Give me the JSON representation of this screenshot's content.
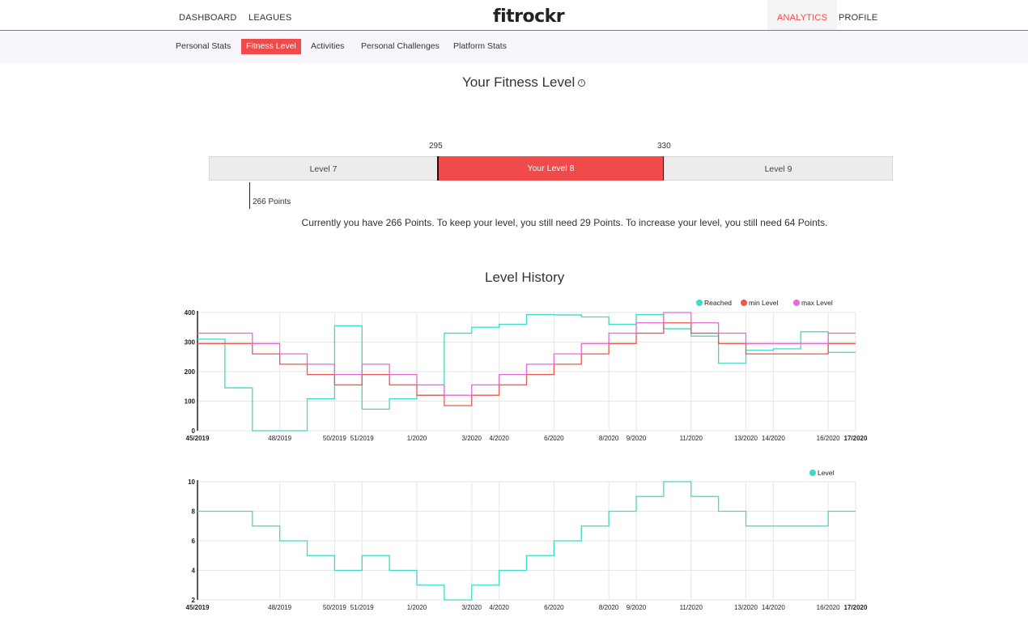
{
  "topnav": {
    "left": [
      "DASHBOARD",
      "LEAGUES"
    ],
    "logo": "fitrockr",
    "right": [
      "ANALYTICS",
      "PROFILE"
    ],
    "active": "ANALYTICS"
  },
  "subnav": {
    "tabs": [
      "Personal Stats",
      "Fitness Level",
      "Activities",
      "Personal Challenges",
      "Platform Stats"
    ],
    "active": "Fitness Level"
  },
  "fitness": {
    "title": "Your Fitness Level",
    "info_icon": "info-icon",
    "thresholds": [
      "295",
      "330"
    ],
    "levels": [
      "Level 7",
      "Your Level 8",
      "Level 9"
    ],
    "current_points_label": "266 Points",
    "current_points": 266,
    "summary": "Currently you have 266 Points. To keep your level, you still need 29 Points. To increase your level, you still need 64 Points."
  },
  "history": {
    "title": "Level History"
  },
  "colors": {
    "accent": "#f04a4a",
    "reached": "#3fd9c6",
    "min_level": "#e8584f",
    "max_level": "#e76ad3"
  },
  "chart_data": [
    {
      "type": "line",
      "step": true,
      "x": [
        "45/2019",
        "46/2019",
        "47/2019",
        "48/2019",
        "49/2019",
        "50/2019",
        "51/2019",
        "52/2019",
        "1/2020",
        "2/2020",
        "3/2020",
        "4/2020",
        "5/2020",
        "6/2020",
        "7/2020",
        "8/2020",
        "9/2020",
        "10/2020",
        "11/2020",
        "12/2020",
        "13/2020",
        "14/2020",
        "15/2020",
        "16/2020",
        "17/2020"
      ],
      "x_tick_labels": [
        "45/2019",
        "48/2019",
        "50/2019",
        "51/2019",
        "1/2020",
        "3/2020",
        "4/2020",
        "6/2020",
        "8/2020",
        "9/2020",
        "11/2020",
        "13/2020",
        "14/2020",
        "16/2020",
        "17/2020"
      ],
      "series": [
        {
          "name": "Reached",
          "color": "#3fd9c6",
          "values": [
            310,
            145,
            0,
            0,
            108,
            355,
            73,
            108,
            120,
            330,
            350,
            360,
            393,
            392,
            385,
            360,
            393,
            345,
            320,
            228,
            272,
            277,
            335,
            265,
            265
          ]
        },
        {
          "name": "min Level",
          "color": "#e8584f",
          "values": [
            295,
            295,
            260,
            225,
            190,
            155,
            190,
            155,
            120,
            85,
            120,
            155,
            190,
            225,
            260,
            295,
            330,
            365,
            330,
            295,
            260,
            260,
            260,
            295,
            295
          ]
        },
        {
          "name": "max Level",
          "color": "#e76ad3",
          "values": [
            330,
            330,
            295,
            260,
            225,
            190,
            225,
            190,
            155,
            120,
            155,
            190,
            225,
            260,
            295,
            330,
            365,
            400,
            365,
            330,
            295,
            295,
            295,
            330,
            330
          ]
        }
      ],
      "ylim": [
        0,
        400
      ],
      "y_ticks": [
        0,
        100,
        200,
        300,
        400
      ],
      "grid": true,
      "legend": "top-right"
    },
    {
      "type": "line",
      "step": true,
      "x": [
        "45/2019",
        "46/2019",
        "47/2019",
        "48/2019",
        "49/2019",
        "50/2019",
        "51/2019",
        "52/2019",
        "1/2020",
        "2/2020",
        "3/2020",
        "4/2020",
        "5/2020",
        "6/2020",
        "7/2020",
        "8/2020",
        "9/2020",
        "10/2020",
        "11/2020",
        "12/2020",
        "13/2020",
        "14/2020",
        "15/2020",
        "16/2020",
        "17/2020"
      ],
      "x_tick_labels": [
        "45/2019",
        "48/2019",
        "50/2019",
        "51/2019",
        "1/2020",
        "3/2020",
        "4/2020",
        "6/2020",
        "8/2020",
        "9/2020",
        "11/2020",
        "13/2020",
        "14/2020",
        "16/2020",
        "17/2020"
      ],
      "series": [
        {
          "name": "Level",
          "color": "#3fd9c6",
          "values": [
            8,
            8,
            7,
            6,
            5,
            4,
            5,
            4,
            3,
            2,
            3,
            4,
            5,
            6,
            7,
            8,
            9,
            10,
            9,
            8,
            7,
            7,
            7,
            8,
            8
          ]
        }
      ],
      "ylim": [
        2,
        10
      ],
      "y_ticks": [
        2,
        4,
        6,
        8,
        10
      ],
      "grid": true,
      "legend": "top-right"
    }
  ]
}
